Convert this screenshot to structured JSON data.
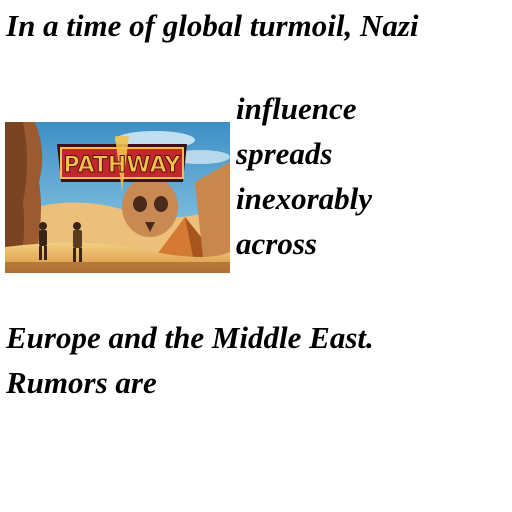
{
  "story": {
    "lines": [
      "In a time of global turmoil, Nazi",
      "influence",
      "spreads",
      "inexorably",
      "across",
      "Europe and the Middle East.",
      "Rumors are"
    ]
  },
  "artwork": {
    "logo_text": "PATHWAY",
    "colors": {
      "sky": "#5fb3d8",
      "sand": "#e8b764",
      "rock": "#b3693a",
      "logo_red": "#c2272d",
      "logo_gold": "#f0c24a"
    }
  }
}
